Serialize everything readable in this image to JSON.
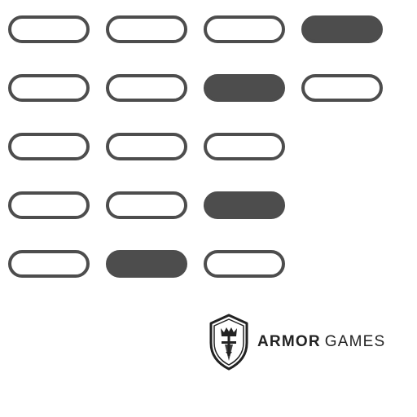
{
  "grid": {
    "rows": [
      {
        "cells": [
          "outline",
          "outline",
          "outline",
          "filled"
        ]
      },
      {
        "cells": [
          "outline",
          "outline",
          "filled",
          "outline"
        ]
      },
      {
        "cells": [
          "outline",
          "outline",
          "outline"
        ]
      },
      {
        "cells": [
          "outline",
          "outline",
          "filled"
        ]
      },
      {
        "cells": [
          "outline",
          "filled",
          "outline"
        ]
      }
    ]
  },
  "colors": {
    "pill": "#4d4d4d",
    "background": "#ffffff",
    "brand_text": "#222222"
  },
  "logo": {
    "icon": "armor-games-shield-icon",
    "brand_bold": "ARMOR",
    "brand_light": "GAMES"
  }
}
